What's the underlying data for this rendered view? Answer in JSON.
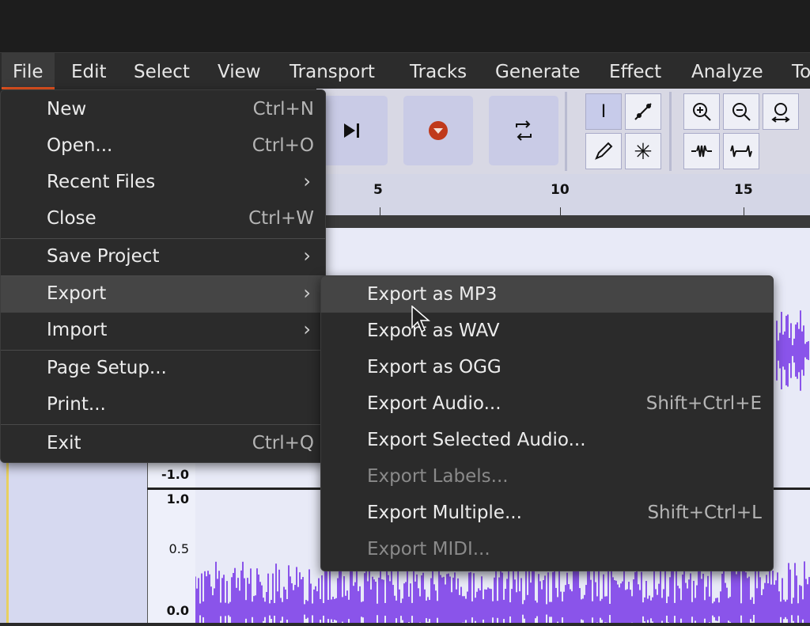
{
  "menubar": {
    "items": [
      {
        "label": "File"
      },
      {
        "label": "Edit"
      },
      {
        "label": "Select"
      },
      {
        "label": "View"
      },
      {
        "label": "Transport"
      },
      {
        "label": "Tracks"
      },
      {
        "label": "Generate"
      },
      {
        "label": "Effect"
      },
      {
        "label": "Analyze"
      },
      {
        "label": "To"
      }
    ]
  },
  "file_menu": {
    "items": [
      {
        "label": "New",
        "shortcut": "Ctrl+N"
      },
      {
        "label": "Open...",
        "shortcut": "Ctrl+O"
      },
      {
        "label": "Recent Files"
      },
      {
        "label": "Close",
        "shortcut": "Ctrl+W"
      },
      {
        "label": "Save Project"
      },
      {
        "label": "Export"
      },
      {
        "label": "Import"
      },
      {
        "label": "Page Setup..."
      },
      {
        "label": "Print..."
      },
      {
        "label": "Exit",
        "shortcut": "Ctrl+Q"
      }
    ]
  },
  "export_menu": {
    "items": [
      {
        "label": "Export as MP3"
      },
      {
        "label": "Export as WAV"
      },
      {
        "label": "Export as OGG"
      },
      {
        "label": "Export Audio...",
        "shortcut": "Shift+Ctrl+E"
      },
      {
        "label": "Export Selected Audio..."
      },
      {
        "label": "Export Labels...",
        "disabled": true
      },
      {
        "label": "Export Multiple...",
        "shortcut": "Shift+Ctrl+L"
      },
      {
        "label": "Export MIDI...",
        "disabled": true
      }
    ]
  },
  "timeline": {
    "ticks": [
      "5",
      "10",
      "15"
    ]
  },
  "track": {
    "scale_top": [
      "-1.0"
    ],
    "scale_bottom": [
      "1.0",
      "0.5",
      "0.0"
    ]
  },
  "colors": {
    "waveform": "#6a22e6",
    "highlight_accent": "#e95420",
    "record": "#c0391b"
  },
  "icons": [
    "skip-end-icon",
    "record-icon",
    "loop-icon",
    "selection-tool-icon",
    "envelope-tool-icon",
    "draw-tool-icon",
    "multi-tool-icon",
    "zoom-in-icon",
    "zoom-out-icon",
    "fit-selection-icon",
    "trim-outside-icon",
    "silence-selection-icon"
  ]
}
